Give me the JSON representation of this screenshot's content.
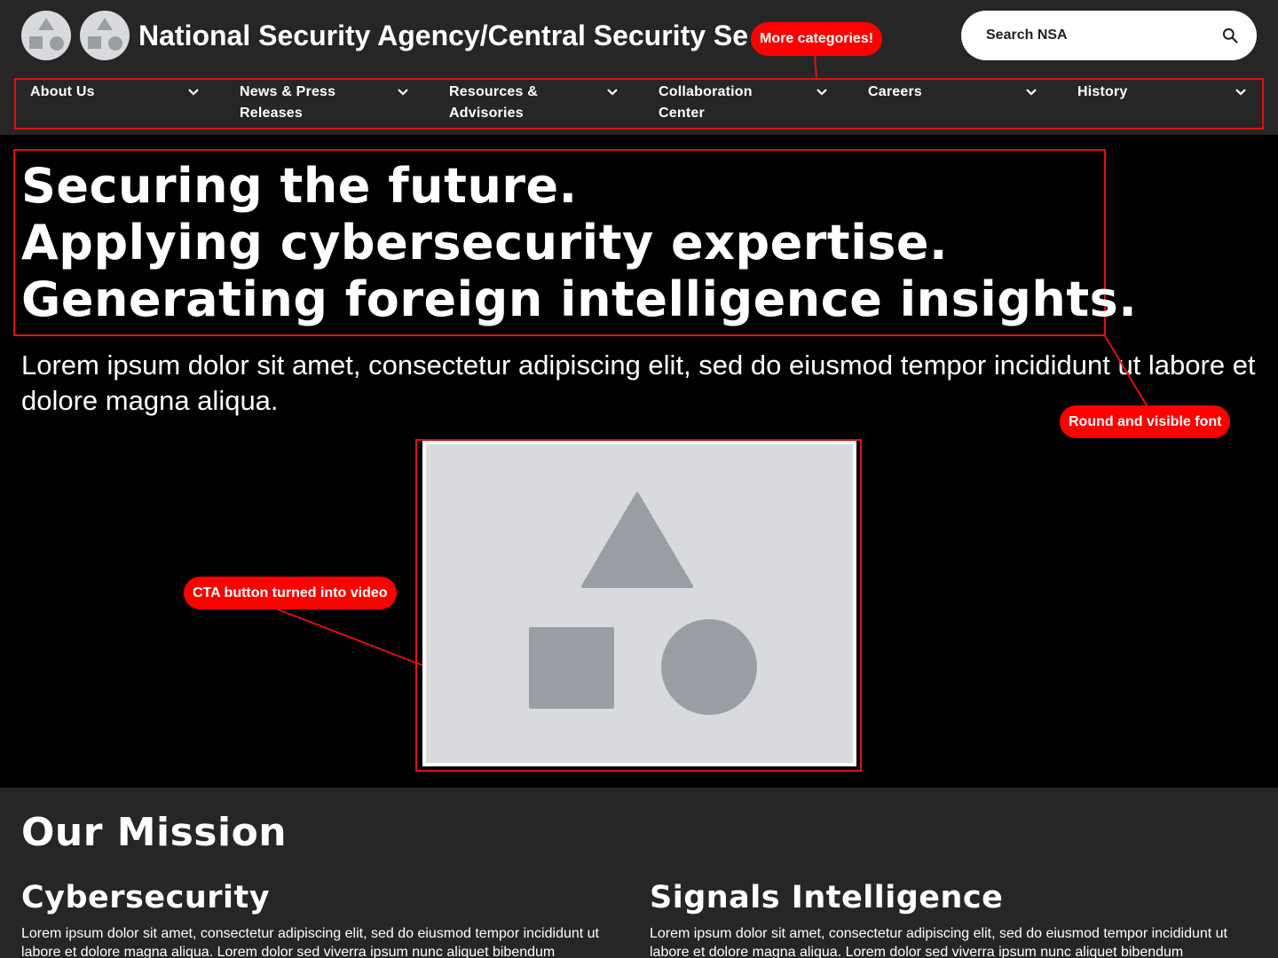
{
  "header": {
    "site_title": "National Security Agency/Central Security Service",
    "logos": [
      "shapes-logo-icon",
      "shapes-logo-icon"
    ],
    "search": {
      "placeholder": "Search NSA",
      "icon": "search-icon"
    }
  },
  "nav": {
    "items": [
      {
        "label": "About Us",
        "icon": "chevron-down-icon"
      },
      {
        "label": "News & Press Releases",
        "icon": "chevron-down-icon"
      },
      {
        "label": "Resources & Advisories",
        "icon": "chevron-down-icon"
      },
      {
        "label": "Collaboration Center",
        "icon": "chevron-down-icon"
      },
      {
        "label": "Careers",
        "icon": "chevron-down-icon"
      },
      {
        "label": "History",
        "icon": "chevron-down-icon"
      }
    ]
  },
  "hero": {
    "line1": "Securing the future.",
    "line2": "Applying cybersecurity expertise.",
    "line3": "Generating foreign intelligence insights.",
    "description": "Lorem ipsum dolor sit amet, consectetur adipiscing elit, sed do eiusmod tempor incididunt ut labore et dolore magna aliqua."
  },
  "video": {
    "placeholder_icon": "image-placeholder-icon"
  },
  "annotations": {
    "more_categories": "More categories!",
    "round_font": "Round and visible font",
    "cta_video": "CTA button turned into video"
  },
  "mission": {
    "title": "Our Mission",
    "columns": [
      {
        "title": "Cybersecurity",
        "text": "Lorem ipsum dolor sit amet, consectetur adipiscing elit, sed do eiusmod tempor incididunt ut labore et dolore magna aliqua. Lorem dolor sed viverra ipsum nunc aliquet bibendum"
      },
      {
        "title": "Signals Intelligence",
        "text": "Lorem ipsum dolor sit amet, consectetur adipiscing elit, sed do eiusmod tempor incididunt ut labore et dolore magna aliqua. Lorem dolor sed viverra ipsum nunc aliquet bibendum"
      }
    ]
  },
  "colors": {
    "header_bg": "#262626",
    "page_bg": "#000000",
    "annotation_red": "#ff0000",
    "placeholder_bg": "#d9dadd",
    "placeholder_shape": "#9a9ea4"
  }
}
